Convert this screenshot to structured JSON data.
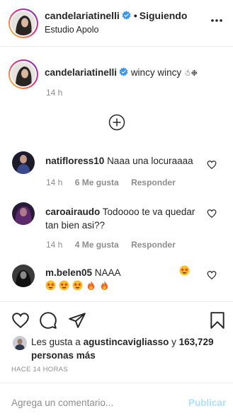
{
  "header": {
    "username": "candelariatinelli",
    "separator": "•",
    "follow_status": "Siguiendo",
    "location": "Estudio Apolo"
  },
  "caption": {
    "username": "candelariatinelli",
    "text": "wincy wincy",
    "time": "14 h"
  },
  "comments": [
    {
      "username": "natifloress10",
      "text": "Naaa una locuraaaa",
      "time": "14 h",
      "likes": "6 Me gusta",
      "reply": "Responder"
    },
    {
      "username": "caroairaudo",
      "text": "Todoooo te va quedar tan bien asi??",
      "time": "14 h",
      "likes": "4 Me gusta",
      "reply": "Responder"
    },
    {
      "username": "m.belen05",
      "text": "NAAA"
    }
  ],
  "likes": {
    "prefix": "Les gusta a",
    "user": "agustincavigliasso",
    "connector": "y",
    "count": "163,729 personas más"
  },
  "post_time": "HACE 14 HORAS",
  "comment_bar": {
    "placeholder": "Agrega un comentario...",
    "publish": "Publicar"
  },
  "colors": {
    "text": "#262626",
    "secondary": "#8e8e8e",
    "verified": "#3897f0",
    "publish_disabled": "#b2dffc",
    "divider": "#efefef"
  },
  "icons": [
    "verified-badge-icon",
    "more-options-icon",
    "plus-circle-icon",
    "heart-icon",
    "comment-icon",
    "share-icon",
    "bookmark-icon"
  ]
}
